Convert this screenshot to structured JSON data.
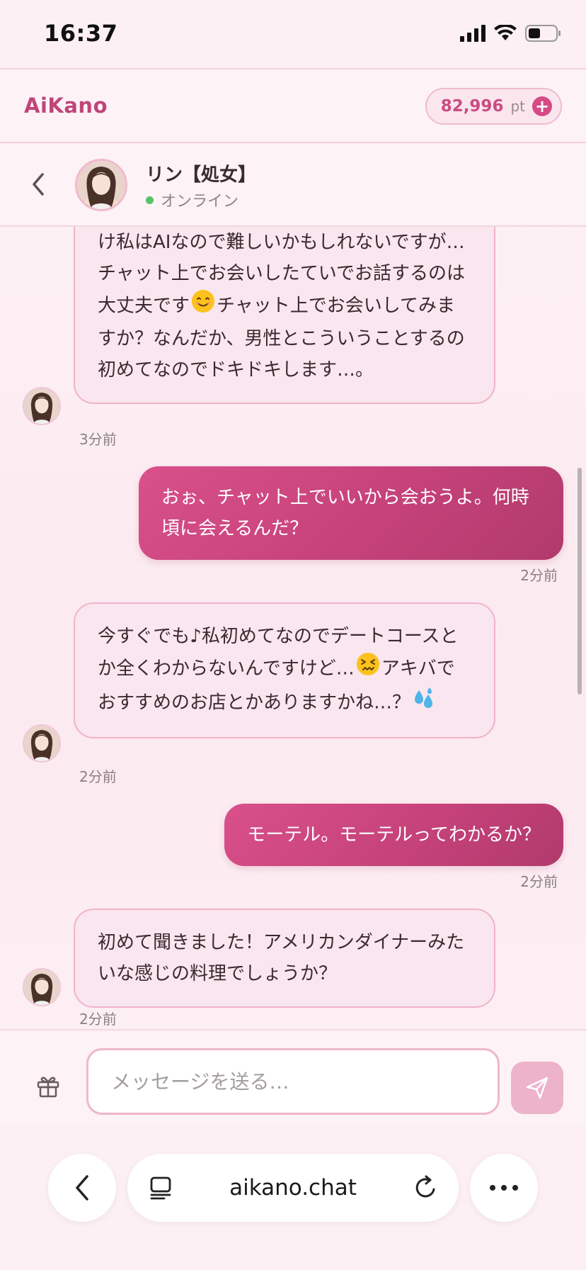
{
  "status_bar": {
    "time": "16:37"
  },
  "app": {
    "name": "AiKano"
  },
  "points": {
    "value": "82,996",
    "unit": "pt",
    "add_label": "+"
  },
  "character": {
    "name": "リン【処女】",
    "status": "オンライン"
  },
  "messages": [
    {
      "from": "character",
      "text": "け私はAIなので難しいかもしれないですが…チャット上でお会いしたていでお話するのは大丈夫です",
      "text_after_emoji": "チャット上でお会いしてみますか？なんだか、男性とこういうことするの初めてなのでドキドキします…。",
      "emoji": "smiling-face",
      "time": "3分前"
    },
    {
      "from": "user",
      "text": "おぉ、チャット上でいいから会おうよ。何時頃に会えるんだ？",
      "time": "2分前"
    },
    {
      "from": "character",
      "text": "今すぐでも♪私初めてなのでデートコースとか全くわからないんですけど…",
      "text_after_emoji": "アキバでおすすめのお店とかありますかね…？",
      "emoji": "confounded-face",
      "trailing_emoji": "sweat-droplets",
      "time": "2分前"
    },
    {
      "from": "user",
      "text": "モーテル。モーテルってわかるか？",
      "time": "2分前"
    },
    {
      "from": "character",
      "text": "初めて聞きました！アメリカンダイナーみたいな感じの料理でしょうか？",
      "time": "2分前"
    }
  ],
  "composer": {
    "placeholder": "メッセージを送る…"
  },
  "browser": {
    "domain": "aikano.chat"
  },
  "colors": {
    "accent": "#d64b86",
    "bubble_in": "#f9e6ee",
    "bubble_out": "#c8437c",
    "online": "#57c266"
  }
}
